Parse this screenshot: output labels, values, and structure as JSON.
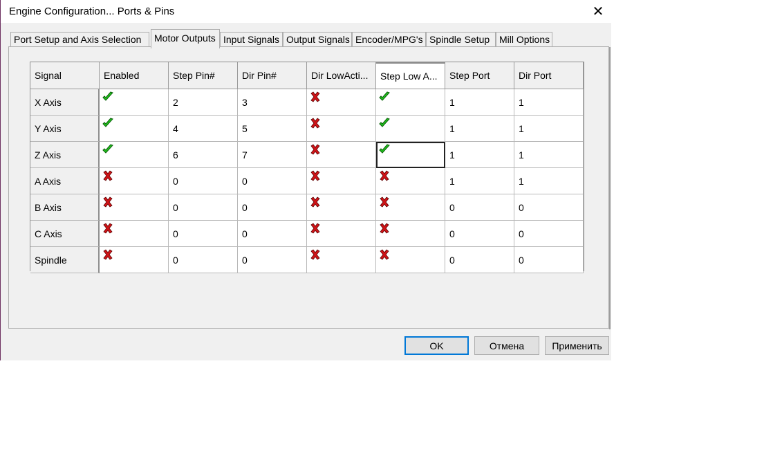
{
  "window": {
    "title": "Engine Configuration... Ports & Pins",
    "close_glyph": "✕"
  },
  "tabs": [
    {
      "label": "Port Setup and Axis Selection",
      "active": false
    },
    {
      "label": "Motor Outputs",
      "active": true
    },
    {
      "label": "Input Signals",
      "active": false
    },
    {
      "label": "Output Signals",
      "active": false
    },
    {
      "label": "Encoder/MPG's",
      "active": false
    },
    {
      "label": "Spindle Setup",
      "active": false
    },
    {
      "label": "Mill Options",
      "active": false
    }
  ],
  "table": {
    "columns": [
      "Signal",
      "Enabled",
      "Step Pin#",
      "Dir Pin#",
      "Dir LowActi...",
      "Step Low A...",
      "Step Port",
      "Dir Port"
    ],
    "rows": [
      {
        "signal": "X Axis",
        "enabled": true,
        "step_pin": "2",
        "dir_pin": "3",
        "dir_low_active": false,
        "step_low_active": true,
        "step_port": "1",
        "dir_port": "1"
      },
      {
        "signal": "Y Axis",
        "enabled": true,
        "step_pin": "4",
        "dir_pin": "5",
        "dir_low_active": false,
        "step_low_active": true,
        "step_port": "1",
        "dir_port": "1"
      },
      {
        "signal": "Z Axis",
        "enabled": true,
        "step_pin": "6",
        "dir_pin": "7",
        "dir_low_active": false,
        "step_low_active": true,
        "step_port": "1",
        "dir_port": "1"
      },
      {
        "signal": "A Axis",
        "enabled": false,
        "step_pin": "0",
        "dir_pin": "0",
        "dir_low_active": false,
        "step_low_active": false,
        "step_port": "1",
        "dir_port": "1"
      },
      {
        "signal": "B Axis",
        "enabled": false,
        "step_pin": "0",
        "dir_pin": "0",
        "dir_low_active": false,
        "step_low_active": false,
        "step_port": "0",
        "dir_port": "0"
      },
      {
        "signal": "C Axis",
        "enabled": false,
        "step_pin": "0",
        "dir_pin": "0",
        "dir_low_active": false,
        "step_low_active": false,
        "step_port": "0",
        "dir_port": "0"
      },
      {
        "signal": "Spindle",
        "enabled": false,
        "step_pin": "0",
        "dir_pin": "0",
        "dir_low_active": false,
        "step_low_active": false,
        "step_port": "0",
        "dir_port": "0"
      }
    ],
    "selected_column": "Step Low A...",
    "focused_cell": {
      "row": "Z Axis",
      "column": "Step Low A..."
    }
  },
  "icons": {
    "true": "green-check-icon",
    "false": "red-x-icon"
  },
  "colors": {
    "check_green": "#22c41e",
    "x_red": "#d01418",
    "focus_accent": "#0078d7"
  },
  "buttons": {
    "ok": "OK",
    "cancel": "Отмена",
    "apply": "Применить"
  }
}
